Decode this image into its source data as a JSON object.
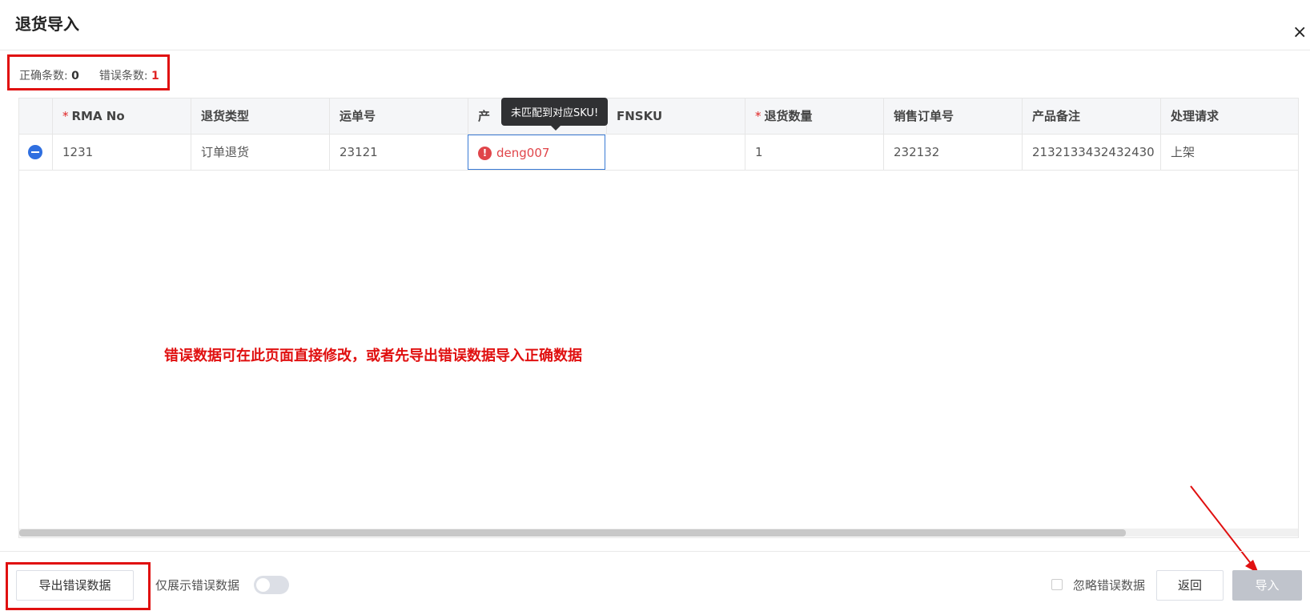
{
  "dialog": {
    "title": "退货导入",
    "close_icon": "×"
  },
  "counts": {
    "correct_label": "正确条数:",
    "correct_value": "0",
    "error_label": "错误条数:",
    "error_value": "1"
  },
  "table": {
    "columns": [
      {
        "label": "",
        "required": false
      },
      {
        "label": "RMA No",
        "required": true
      },
      {
        "label": "退货类型",
        "required": false
      },
      {
        "label": "运单号",
        "required": false
      },
      {
        "label": "产",
        "required": false
      },
      {
        "label": "FNSKU",
        "required": false
      },
      {
        "label": "退货数量",
        "required": true
      },
      {
        "label": "销售订单号",
        "required": false
      },
      {
        "label": "产品备注",
        "required": false
      },
      {
        "label": "处理请求",
        "required": false
      }
    ],
    "required_mark": "*",
    "rows": [
      {
        "rma": "1231",
        "type": "订单退货",
        "waybill": "23121",
        "sku": "deng007",
        "fnsku": "",
        "qty": "1",
        "order": "232132",
        "remark": "2132133432432430",
        "request": "上架"
      }
    ],
    "error_tooltip": "未匹配到对应SKU!",
    "error_icon": "!"
  },
  "annotation": "错误数据可在此页面直接修改，或者先导出错误数据导入正确数据",
  "footer": {
    "export_button": "导出错误数据",
    "toggle_label": "仅展示错误数据",
    "toggle_on": false,
    "ignore_label": "忽略错误数据",
    "ignore_checked": false,
    "back_button": "返回",
    "import_button": "导入"
  },
  "colors": {
    "error": "#e0454a",
    "highlight_box": "#e01010",
    "primary": "#2f6fe0"
  }
}
